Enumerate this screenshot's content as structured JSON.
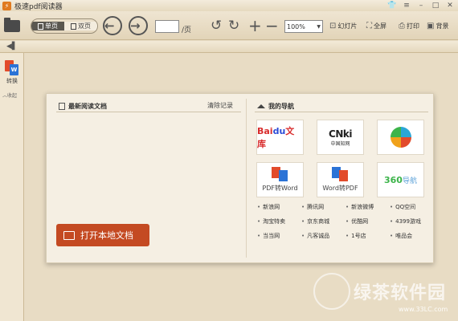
{
  "window": {
    "title": "极速pdf阅读器",
    "controls": [
      "shirt-icon",
      "menu-icon",
      "minimize-icon",
      "maximize-icon",
      "close-icon"
    ]
  },
  "toolbar": {
    "view_single": "单页",
    "view_double": "双页",
    "page_value": "",
    "page_suffix": "/页",
    "zoom": "100%",
    "slideshow": "幻灯片",
    "fullscreen": "全屏",
    "print": "打印",
    "background": "背景"
  },
  "sidebar": {
    "convert_label": "转换",
    "collapse_label": "收起"
  },
  "recent": {
    "title": "最新阅读文档",
    "clear": "清除记录",
    "open_button": "打开本地文档"
  },
  "nav": {
    "title": "我的导航",
    "tiles": {
      "baidu_a": "Bai",
      "baidu_b": "du",
      "baidu_c": "文库",
      "cnki": "CNki",
      "cnki_sub": "中国知网",
      "pdf_to_word": "PDF转Word",
      "word_to_pdf": "Word转PDF",
      "nav360_a": "360",
      "nav360_b": "导航"
    },
    "links": [
      "新浪网",
      "腾讯网",
      "新浪微博",
      "QQ空间",
      "淘宝特卖",
      "京东商城",
      "优酷网",
      "4399游戏",
      "当当网",
      "凡客诚品",
      "1号店",
      "唯品会"
    ]
  },
  "watermark": {
    "text": "绿茶软件园",
    "url": "www.33LC.com"
  },
  "colors": {
    "accent_button": "#c44a22",
    "background": "#e8dcc4"
  }
}
